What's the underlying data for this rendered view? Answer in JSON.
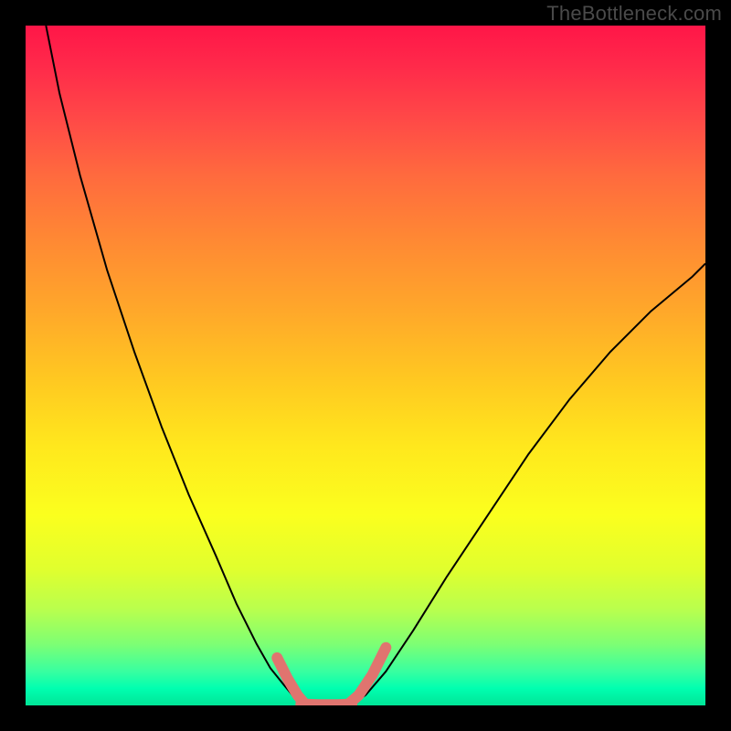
{
  "watermark": "TheBottleneck.com",
  "chart_data": {
    "type": "line",
    "title": "",
    "xlabel": "",
    "ylabel": "",
    "xlim": [
      0,
      100
    ],
    "ylim": [
      0,
      100
    ],
    "gradient_stops": [
      {
        "pos": 0,
        "color": "#ff1648"
      },
      {
        "pos": 0.06,
        "color": "#ff2a4a"
      },
      {
        "pos": 0.14,
        "color": "#ff4a47"
      },
      {
        "pos": 0.22,
        "color": "#ff6a3e"
      },
      {
        "pos": 0.32,
        "color": "#ff8a33"
      },
      {
        "pos": 0.42,
        "color": "#ffa82a"
      },
      {
        "pos": 0.52,
        "color": "#ffc821"
      },
      {
        "pos": 0.62,
        "color": "#ffe81d"
      },
      {
        "pos": 0.72,
        "color": "#fbff1e"
      },
      {
        "pos": 0.8,
        "color": "#e0ff2e"
      },
      {
        "pos": 0.86,
        "color": "#b8ff4e"
      },
      {
        "pos": 0.91,
        "color": "#7dff74"
      },
      {
        "pos": 0.95,
        "color": "#38ffa0"
      },
      {
        "pos": 0.975,
        "color": "#00ffb0"
      },
      {
        "pos": 1.0,
        "color": "#00e597"
      }
    ],
    "series": [
      {
        "name": "left-curve",
        "color": "#000000",
        "width": 2,
        "x": [
          3,
          5,
          8,
          12,
          16,
          20,
          24,
          28,
          31,
          34,
          36,
          38,
          39.5,
          40.5
        ],
        "y": [
          100,
          90,
          78,
          64,
          52,
          41,
          31,
          22,
          15,
          9,
          5.5,
          3,
          1.2,
          0.2
        ]
      },
      {
        "name": "right-curve",
        "color": "#000000",
        "width": 2,
        "x": [
          48,
          50,
          53,
          57,
          62,
          68,
          74,
          80,
          86,
          92,
          98,
          100
        ],
        "y": [
          0.2,
          1.5,
          5,
          11,
          19,
          28,
          37,
          45,
          52,
          58,
          63,
          65
        ]
      },
      {
        "name": "pink-left-tail",
        "color": "#e0746f",
        "width": 12,
        "cap": "round",
        "x": [
          37,
          38.5,
          40,
          41
        ],
        "y": [
          7,
          4,
          1.5,
          0.3
        ]
      },
      {
        "name": "pink-flat",
        "color": "#e0746f",
        "width": 12,
        "cap": "round",
        "x": [
          40.5,
          43,
          46,
          48
        ],
        "y": [
          0.2,
          0.1,
          0.1,
          0.2
        ]
      },
      {
        "name": "pink-right-tail",
        "color": "#e0746f",
        "width": 12,
        "cap": "round",
        "x": [
          47.5,
          49,
          51,
          53
        ],
        "y": [
          0.2,
          1.5,
          4.5,
          8.5
        ]
      }
    ]
  }
}
